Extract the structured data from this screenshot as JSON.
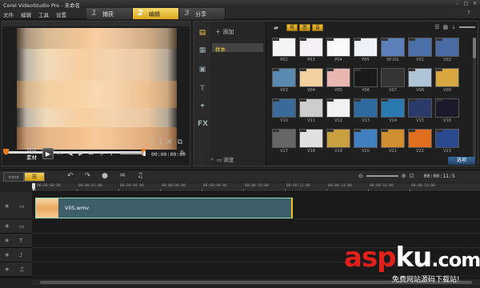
{
  "window": {
    "title": "Corel VideoStudio Pro - 未命名"
  },
  "menu": {
    "items": [
      "文件",
      "编辑",
      "工具",
      "设置"
    ]
  },
  "steps": [
    {
      "num": "1",
      "label": "捕获",
      "active": false
    },
    {
      "num": "2",
      "label": "编辑",
      "active": true
    },
    {
      "num": "3",
      "label": "分享",
      "active": false
    }
  ],
  "preview": {
    "project_label": "项目",
    "clip_label": "素材",
    "timecode": "00:00:00:00",
    "trim_in": "[",
    "trim_out": "]"
  },
  "library": {
    "add_label": "添加",
    "folders": [
      "样本"
    ],
    "browse_label": "浏览",
    "options_label": "选项",
    "filters": [
      "视",
      "图",
      "音"
    ],
    "thumbnails": [
      {
        "caption": "P02",
        "color": "#f4f4f4"
      },
      {
        "caption": "P03",
        "color": "#f6f0f6"
      },
      {
        "caption": "P04",
        "color": "#fafafa"
      },
      {
        "caption": "P05",
        "color": "#eef2f8"
      },
      {
        "caption": "SP-I01",
        "color": "#5b7fb8"
      },
      {
        "caption": "V01",
        "color": "#4b6fa8"
      },
      {
        "caption": "V02",
        "color": "#4a6aa6"
      },
      {
        "caption": "V03",
        "color": "#5a8ab0"
      },
      {
        "caption": "V04",
        "color": "#f2d0a0"
      },
      {
        "caption": "V05",
        "color": "#e8b8b0"
      },
      {
        "caption": "V06",
        "color": "#1a1a1a"
      },
      {
        "caption": "V07",
        "color": "#333333"
      },
      {
        "caption": "V08",
        "color": "#b0c4d8"
      },
      {
        "caption": "V09",
        "color": "#d8a840"
      },
      {
        "caption": "V10",
        "color": "#3a6a9a"
      },
      {
        "caption": "V11",
        "color": "#cccccc"
      },
      {
        "caption": "V12",
        "color": "#f0f0f0"
      },
      {
        "caption": "V13",
        "color": "#2e6a9e"
      },
      {
        "caption": "V14",
        "color": "#2a7ab0"
      },
      {
        "caption": "V15",
        "color": "#2a3a6a"
      },
      {
        "caption": "V16",
        "color": "#1a1a2a"
      },
      {
        "caption": "V17",
        "color": "#666666"
      },
      {
        "caption": "V18",
        "color": "#e0e0e0"
      },
      {
        "caption": "V19",
        "color": "#c8a040"
      },
      {
        "caption": "V20",
        "color": "#4080c0"
      },
      {
        "caption": "V21",
        "color": "#d09030"
      },
      {
        "caption": "V22",
        "color": "#e07020"
      },
      {
        "caption": "V23",
        "color": "#2a4a90"
      }
    ]
  },
  "timeline": {
    "view_buttons": [
      "故事板",
      "时间轴"
    ],
    "timecode": "00:00:11:5",
    "ruler_marks": [
      "00:00:00:00",
      "00:00:02:00",
      "00:00:04:00",
      "00:00:06:00",
      "00:00:08:00",
      "00:00:10:00",
      "00:00:12:00",
      "00:00:14:00",
      "00:00:16:00",
      "00:00:18:00"
    ],
    "clip_name": "V05.wmv"
  },
  "watermark": {
    "logo_asp": "asp",
    "logo_ku": "ku",
    "logo_com": ".com",
    "subtitle": "免费网站源码下载站!"
  },
  "colors": {
    "accent": "#e8b82a",
    "clip": "#3e5e6a",
    "watermark_red": "#e0201a"
  }
}
